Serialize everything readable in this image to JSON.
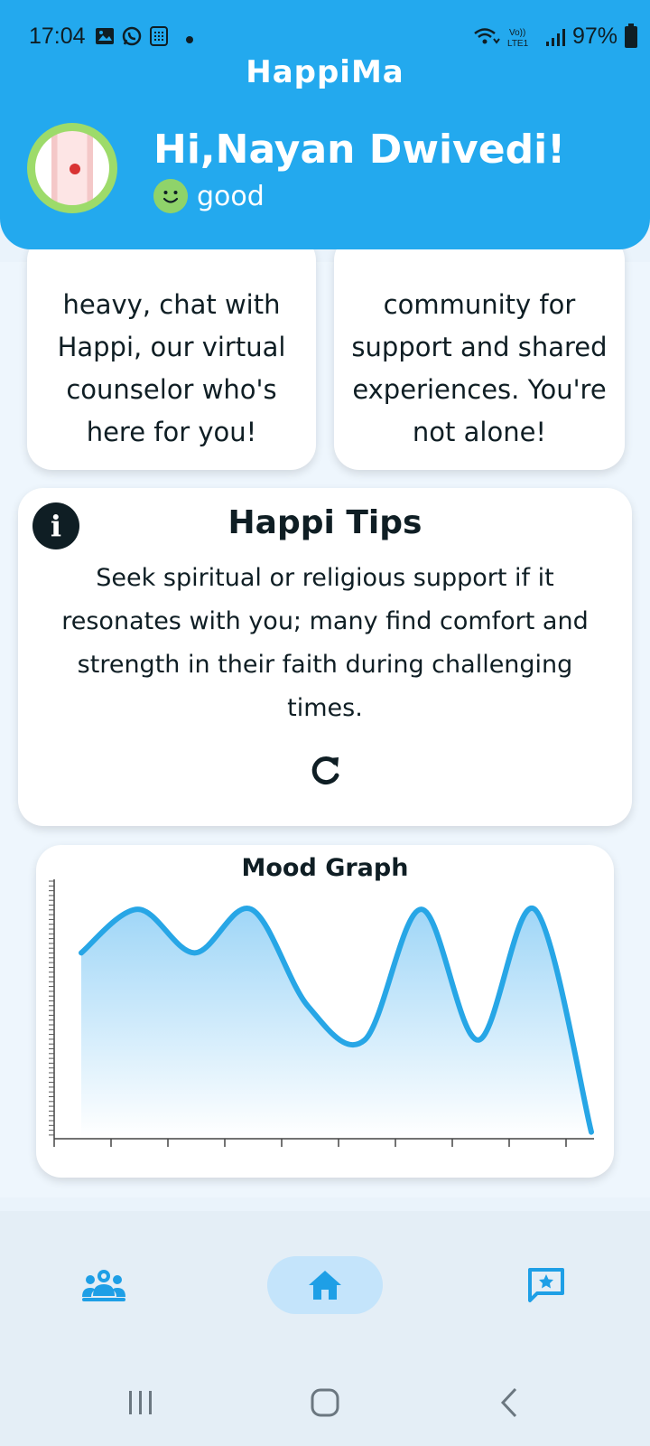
{
  "status_bar": {
    "time": "17:04",
    "battery": "97%"
  },
  "header": {
    "app_title": "HappiMa",
    "greeting": "Hi,Nayan Dwivedi!",
    "mood": "good"
  },
  "feature_cards": [
    {
      "text": "heavy, chat with Happi, our virtual counselor who's here for you!"
    },
    {
      "text": "community for support and shared experiences. You're not alone!"
    }
  ],
  "tips": {
    "title": "Happi Tips",
    "body": "Seek spiritual or religious support if it resonates with you; many find comfort and strength in their faith during challenging times."
  },
  "chart_data": {
    "type": "area",
    "title": "Mood Graph",
    "xlabel": "",
    "ylabel": "",
    "x": [
      1,
      2,
      3,
      4,
      5,
      6,
      7,
      8,
      9,
      10
    ],
    "values": [
      3.8,
      4.7,
      3.8,
      4.7,
      2.7,
      2.0,
      4.7,
      2.0,
      4.7,
      0.1
    ],
    "ylim": [
      0,
      5
    ],
    "grid": false,
    "colors": {
      "line": "#27a6e6",
      "fill_top": "#9fd6f7",
      "fill_bottom": "#ffffff"
    }
  },
  "bottom_nav": {
    "items": [
      {
        "icon": "community-icon",
        "active": false
      },
      {
        "icon": "home-icon",
        "active": true
      },
      {
        "icon": "feedback-icon",
        "active": false
      }
    ]
  },
  "colors": {
    "header_bg": "#23a9ee",
    "accent": "#27a6e6",
    "nav_active_bg": "#c4e4fb"
  }
}
